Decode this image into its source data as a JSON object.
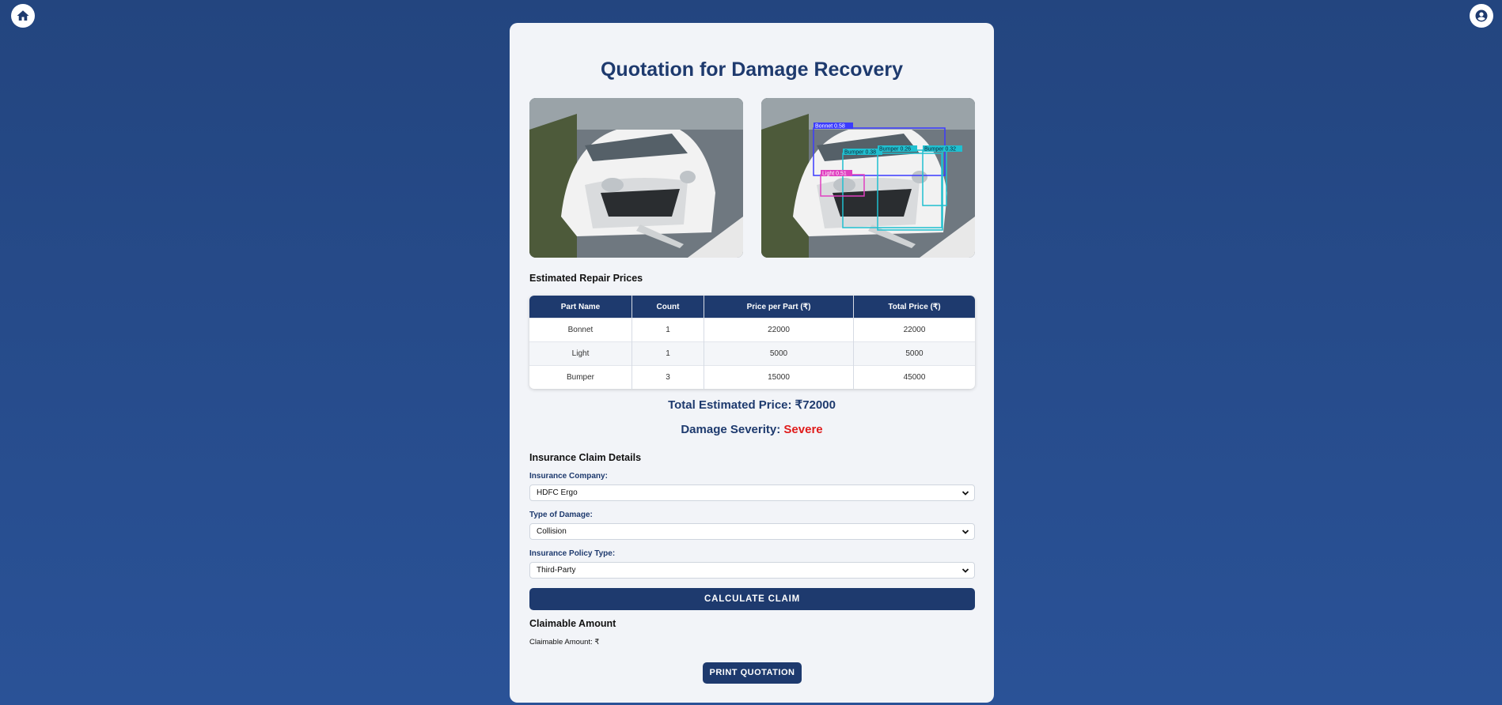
{
  "nav": {
    "home_icon": "home-icon",
    "profile_icon": "user-circle-icon"
  },
  "page_title": "Quotation for Damage Recovery",
  "repair_section": {
    "title": "Estimated Repair Prices",
    "columns": [
      "Part Name",
      "Count",
      "Price per Part (₹)",
      "Total Price (₹)"
    ],
    "rows": [
      [
        "Bonnet",
        "1",
        "22000",
        "22000"
      ],
      [
        "Light",
        "1",
        "5000",
        "5000"
      ],
      [
        "Bumper",
        "3",
        "15000",
        "45000"
      ]
    ]
  },
  "total_estimated": "Total Estimated Price: ₹72000",
  "severity": {
    "label": "Damage Severity:",
    "value": "Severe",
    "value_color": "#e01b1b"
  },
  "detection_labels": [
    "Bonnet 0.58",
    "Bumper 0.38",
    "Bumper 0.26",
    "Bumper 0.32",
    "Light 0.51"
  ],
  "insurance": {
    "section_title": "Insurance Claim Details",
    "company_label": "Insurance Company:",
    "company_value": "HDFC Ergo",
    "damage_label": "Type of Damage:",
    "damage_value": "Collision",
    "policy_label": "Insurance Policy Type:",
    "policy_value": "Third-Party",
    "calculate_label": "CALCULATE CLAIM"
  },
  "claim": {
    "title": "Claimable Amount",
    "text": "Claimable Amount: ₹"
  },
  "print_label": "PRINT QUOTATION",
  "colors": {
    "primary": "#1e3a6e",
    "background": "#2a5297",
    "card": "#f2f4f8"
  }
}
